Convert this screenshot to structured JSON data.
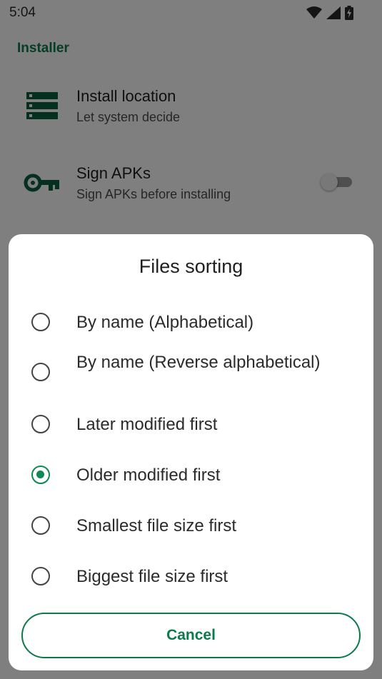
{
  "status_bar": {
    "time": "5:04"
  },
  "settings": {
    "section_header": "Installer",
    "install_location": {
      "title": "Install location",
      "summary": "Let system decide",
      "icon": "storage-icon"
    },
    "sign_apks": {
      "title": "Sign APKs",
      "summary": "Sign APKs before installing",
      "icon": "key-icon",
      "enabled": false
    }
  },
  "dialog": {
    "title": "Files sorting",
    "options": [
      {
        "label": "By name (Alphabetical)",
        "checked": false
      },
      {
        "label": "By name (Reverse alphabetical)",
        "checked": false
      },
      {
        "label": "Later modified first",
        "checked": false
      },
      {
        "label": "Older modified first",
        "checked": true
      },
      {
        "label": "Smallest file size first",
        "checked": false
      },
      {
        "label": "Biggest file size first",
        "checked": false
      }
    ],
    "cancel_label": "Cancel"
  },
  "colors": {
    "accent": "#0b7a4d",
    "scrim": "rgba(0,0,0,0.5)"
  }
}
